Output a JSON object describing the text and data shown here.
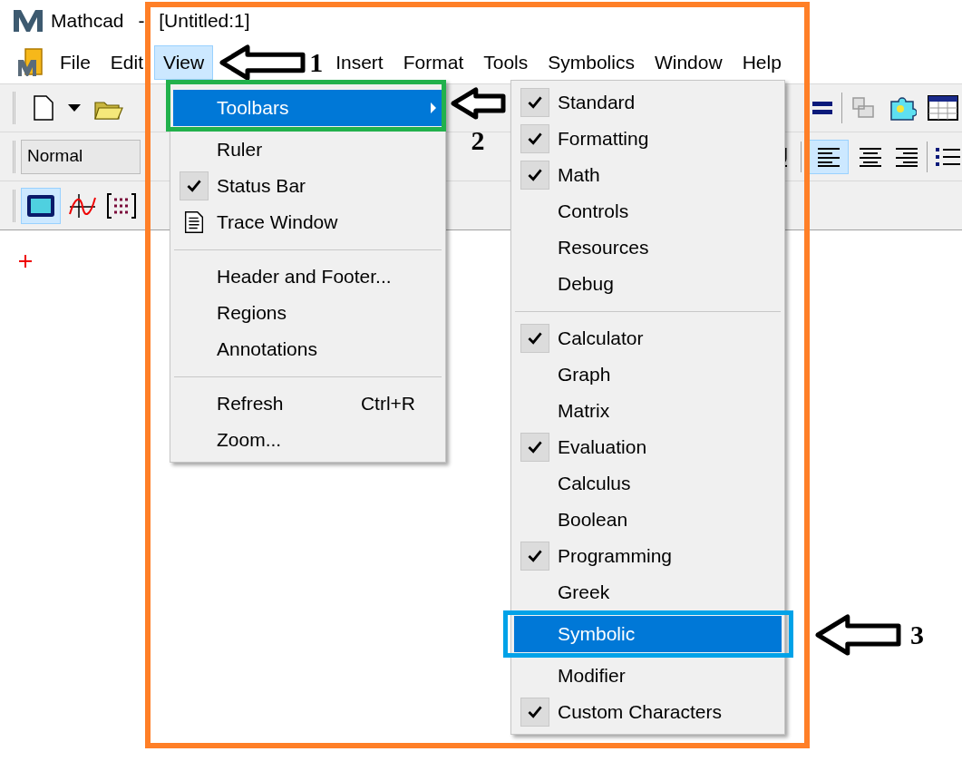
{
  "window": {
    "title": "Mathcad - [Untitled:1]"
  },
  "menu_bar": [
    {
      "label": "File",
      "selected": false
    },
    {
      "label": "Edit",
      "selected": false
    },
    {
      "label": "View",
      "selected": true
    },
    {
      "label": "Insert",
      "selected": false
    },
    {
      "label": "Format",
      "selected": false
    },
    {
      "label": "Tools",
      "selected": false
    },
    {
      "label": "Symbolics",
      "selected": false
    },
    {
      "label": "Window",
      "selected": false
    },
    {
      "label": "Help",
      "selected": false
    }
  ],
  "formatting_toolbar": {
    "style_field": "Normal"
  },
  "view_menu": [
    {
      "kind": "submenu",
      "label": "Toolbars",
      "checked": false,
      "selected": true
    },
    {
      "kind": "item",
      "label": "Ruler",
      "checked": false,
      "selected": false
    },
    {
      "kind": "item",
      "label": "Status Bar",
      "checked": true,
      "selected": false
    },
    {
      "kind": "icon_item",
      "label": "Trace Window",
      "checked": false,
      "selected": false
    },
    {
      "kind": "separator"
    },
    {
      "kind": "item",
      "label": "Header and Footer...",
      "checked": false,
      "selected": false
    },
    {
      "kind": "item",
      "label": "Regions",
      "checked": false,
      "selected": false
    },
    {
      "kind": "item",
      "label": "Annotations",
      "checked": false,
      "selected": false
    },
    {
      "kind": "separator"
    },
    {
      "kind": "item",
      "label": "Refresh",
      "shortcut": "Ctrl+R",
      "checked": false,
      "selected": false
    },
    {
      "kind": "item",
      "label": "Zoom...",
      "checked": false,
      "selected": false
    }
  ],
  "toolbars_submenu": [
    {
      "kind": "item",
      "label": "Standard",
      "checked": true,
      "selected": false
    },
    {
      "kind": "item",
      "label": "Formatting",
      "checked": true,
      "selected": false
    },
    {
      "kind": "item",
      "label": "Math",
      "checked": true,
      "selected": false
    },
    {
      "kind": "item",
      "label": "Controls",
      "checked": false,
      "selected": false
    },
    {
      "kind": "item",
      "label": "Resources",
      "checked": false,
      "selected": false
    },
    {
      "kind": "item",
      "label": "Debug",
      "checked": false,
      "selected": false
    },
    {
      "kind": "separator"
    },
    {
      "kind": "item",
      "label": "Calculator",
      "checked": true,
      "selected": false
    },
    {
      "kind": "item",
      "label": "Graph",
      "checked": false,
      "selected": false
    },
    {
      "kind": "item",
      "label": "Matrix",
      "checked": false,
      "selected": false
    },
    {
      "kind": "item",
      "label": "Evaluation",
      "checked": true,
      "selected": false
    },
    {
      "kind": "item",
      "label": "Calculus",
      "checked": false,
      "selected": false
    },
    {
      "kind": "item",
      "label": "Boolean",
      "checked": false,
      "selected": false
    },
    {
      "kind": "item",
      "label": "Programming",
      "checked": true,
      "selected": false
    },
    {
      "kind": "item",
      "label": "Greek",
      "checked": false,
      "selected": false
    },
    {
      "kind": "item",
      "label": "Symbolic",
      "checked": false,
      "selected": true
    },
    {
      "kind": "item",
      "label": "Modifier",
      "checked": false,
      "selected": false
    },
    {
      "kind": "item",
      "label": "Custom Characters",
      "checked": true,
      "selected": false
    }
  ],
  "highlight_frames": [
    {
      "color": "#ff7f27"
    },
    {
      "color": "#22b14c"
    },
    {
      "color": "#00a2e8"
    }
  ],
  "callouts": [
    {
      "number": "1"
    },
    {
      "number": "2"
    },
    {
      "number": "3"
    }
  ]
}
